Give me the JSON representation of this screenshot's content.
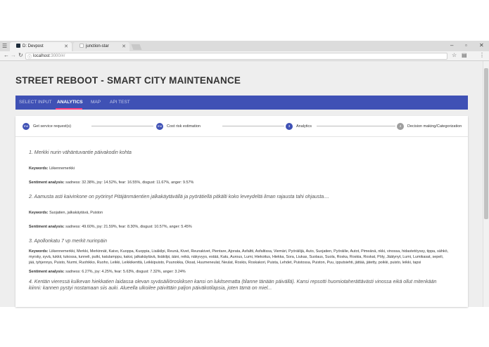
{
  "browser": {
    "tabs": [
      {
        "label": "D: Devpost",
        "active": true
      },
      {
        "label": "junction-star",
        "active": false
      }
    ],
    "url_host": "localhost",
    "url_path": ":3000/#/",
    "icons": {
      "back": "back-arrow-icon",
      "forward": "forward-arrow-icon",
      "reload": "reload-icon",
      "star": "star-icon",
      "menu": "menu-icon"
    }
  },
  "page": {
    "title": "STREET REBOOT - SMART CITY MAINTENANCE",
    "accent": "#3f51b5",
    "indicator": "#ff4081"
  },
  "nav": {
    "tabs": [
      {
        "label": "SELECT INPUT",
        "active": false
      },
      {
        "label": "ANALYTICS",
        "active": true
      },
      {
        "label": "MAP",
        "active": false
      },
      {
        "label": "API TEST",
        "active": false
      }
    ]
  },
  "stepper": {
    "steps": [
      {
        "badge": "mo",
        "label": "Get service request(s)"
      },
      {
        "badge": "mo",
        "label": "Cost risk estimation"
      },
      {
        "badge": "3",
        "label": "Analytics"
      },
      {
        "badge": "4",
        "label": "Decision making/Categorization"
      }
    ]
  },
  "results": {
    "keywords_label": "Keywords:",
    "sentiment_label": "Sentiment analysis:",
    "items": [
      {
        "title": "1. Merkki nurin vähäntuvantie päivakodin kohta",
        "keywords": "Liikennemerkki",
        "sentiment": "sadness: 32.38%, joy: 14.52%, fear: 16.55%, disgust: 11.67%, anger: 9.57%"
      },
      {
        "title": "2. Aamusta asti kaivinkone on pyörinyt Pitäjänmäentien jalkakäytävällä ja pyörätiellä pitkälti koko leveydeltä ilman rajausta tahi ohjausta....",
        "keywords": "Suojatien, jalkakäytävä, Puiston",
        "sentiment": "sadness: 49.60%, joy: 21.59%, fear: 8.30%, disgust: 10.57%, anger: 5.45%"
      },
      {
        "title": "3. Apollonkatu 7 vp merkit nurinpäin",
        "keywords": "Liikennemerkki, Merkki, Merkinnät, Kaivo, Kuoppa, Kuoppia, Lisäkilpi, Reunä, Kivet, Reunakivet, Pientare, Ajorata, Asfaltti, Asfaltissa, Viemäri, Pyöräilijä, Auto, Suojatien, Pyöräilie, Autot, Pimeänä, nkki, vinossa, hidastetöyssy, tippa, sähkö, myrsky, syvä, tukkii, tukossa, tunneli, putki, katulamppu, kaksi, jalkakäytävä, lisäkilpi, ääni, reikä, näkyvyys, estää, Katu, Aurous, Lumi, Hiekoitus, Hiekka, Sora, Liukas, Suolaus, Suola, Roska, Roskia, Roskat, Pöly, Jäätynyt, Lumi, Lumikasat, sepeli, jää, tyhjennys, Puisto, Nurmi, Ruohikko, Ruoho, Leikki, Leikkikenttä, Leikkipuisto, Puunokka, Oksat, Huumeneulat, Neulat, Roskis, Roskakori, Puista, Lehdet, Puistossa, Puiston, Puu, ipputsiehti, jättää, jätetty, poikki, puisto, leikki, tapsi",
        "sentiment": "sadness: 6.27%, joy: 4.25%, fear: 5.63%, disgust: 7.32%, anger: 3.24%"
      },
      {
        "title": "4. Kentän vieressä kulkevan hiekkatien laidassa olevan syväsäiliöroskiksen kansi on lukitsematta (tilanne tänään päivällä). Kansi repsotti huomiotaherättävästi vinossa eikä ollut mitenkään kiinni: kannen pystyi nostamaan siis auki. Alueella ulkoilee päivittäin paljon päiväkotilapsia, joten tämä on miel..."
      }
    ]
  }
}
